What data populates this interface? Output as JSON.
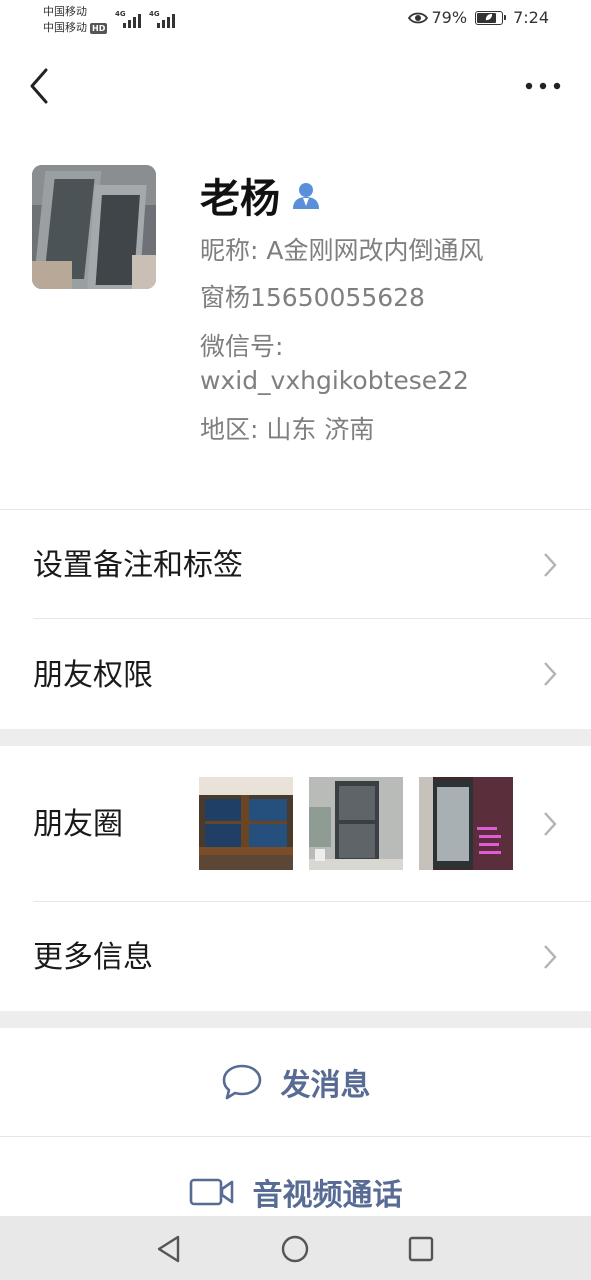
{
  "status_bar": {
    "carrier_1": "中国移动",
    "carrier_2": "中国移动",
    "hd_badge": "HD",
    "network_1": "4G",
    "network_2": "4G",
    "battery": "79%",
    "battery_level": 0.79,
    "time": "7:24"
  },
  "profile": {
    "name": "老杨",
    "nickname": "昵称: A金刚网改内倒通风",
    "nickname_cont": "窗杨15650055628",
    "wechat_id_label": "微信号:",
    "wechat_id": "wxid_vxhgikobtese22",
    "region": "地区: 山东  济南"
  },
  "menu": {
    "remark": "设置备注和标签",
    "permissions": "朋友权限",
    "moments": "朋友圈",
    "more_info": "更多信息"
  },
  "actions": {
    "message": "发消息",
    "call": "音视频通话"
  },
  "colors": {
    "link_blue": "#576b95",
    "contact_icon": "#5b8fd9",
    "divider": "#e6e6e6",
    "gap": "#ededed"
  },
  "icons": {
    "back": "chevron-left-icon",
    "more": "more-dots-icon",
    "contact": "person-icon",
    "chat": "chat-bubble-icon",
    "video": "video-camera-icon"
  }
}
